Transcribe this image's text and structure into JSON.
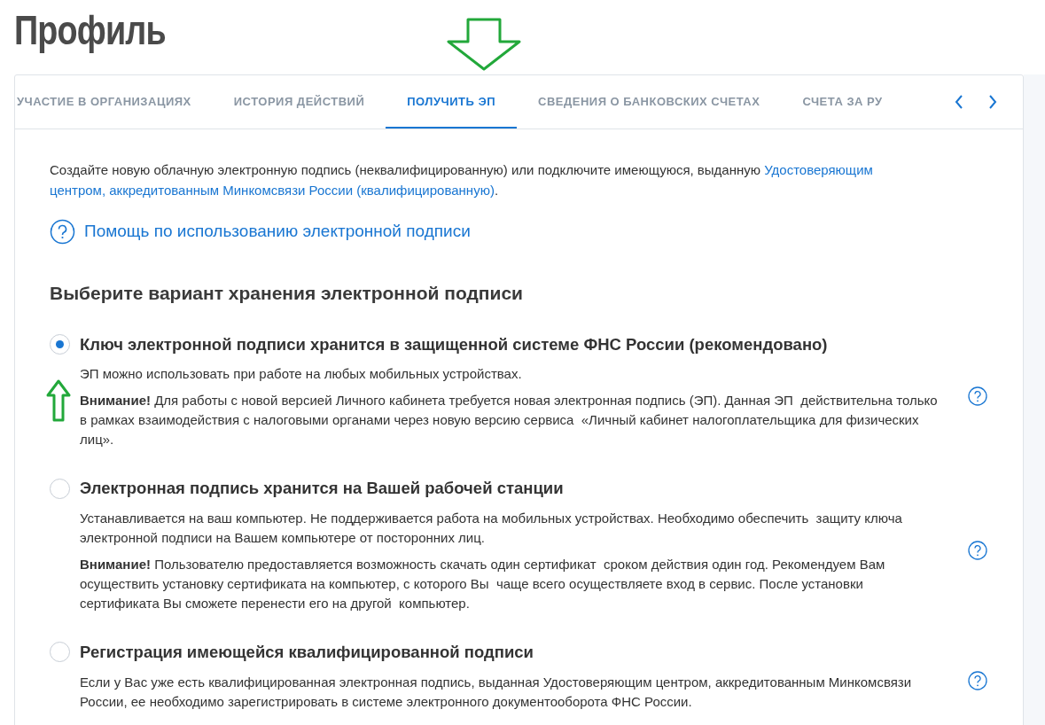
{
  "page_title": "Профиль",
  "tabs": [
    {
      "label": "УЧАСТИЕ В ОРГАНИЗАЦИЯХ",
      "selected": false
    },
    {
      "label": "ИСТОРИЯ ДЕЙСТВИЙ",
      "selected": false
    },
    {
      "label": "ПОЛУЧИТЬ ЭП",
      "selected": true
    },
    {
      "label": "СВЕДЕНИЯ О БАНКОВСКИХ СЧЕТАХ",
      "selected": false
    },
    {
      "label": "СЧЕТА ЗА РУ",
      "selected": false
    }
  ],
  "intro": {
    "text": "Создайте новую облачную электронную подпись (неквалифицированную) или подключите имеющуюся, выданную ",
    "link": "Удостоверяющим центром, аккредитованным Минкомсвязи России (квалифицированную)",
    "after": "."
  },
  "help_link": "Помощь по использованию электронной подписи",
  "section_title": "Выберите вариант хранения электронной подписи",
  "options": [
    {
      "title": "Ключ электронной подписи хранится в защищенной системе ФНС России (рекомендовано)",
      "selected": true,
      "paragraphs": [
        "ЭП можно использовать при работе на любых мобильных устройствах.",
        "**Внимание!** Для работы с новой версией Личного кабинета требуется новая электронная подпись (ЭП). Данная ЭП  действительна только в рамках взаимодействия с налоговыми органами через новую версию сервиса  «Личный кабинет налогоплательщика для физических лиц»."
      ]
    },
    {
      "title": "Электронная подпись хранится на Вашей рабочей станции",
      "selected": false,
      "paragraphs": [
        "Устанавливается на ваш компьютер. Не поддерживается работа на мобильных устройствах. Необходимо обеспечить  защиту ключа электронной подписи на Вашем компьютере от посторонних лиц.",
        "**Внимание!** Пользователю предоставляется возможность скачать один сертификат  сроком действия один год. Рекомендуем Вам осуществить установку сертификата на компьютер, с которого Вы  чаще всего осуществляете вход в сервис. После установки сертификата Вы сможете перенести его на другой  компьютер."
      ]
    },
    {
      "title": "Регистрация имеющейся квалифицированной подписи",
      "selected": false,
      "paragraphs": [
        "Если у Вас уже есть квалифицированная электронная подпись, выданная Удостоверяющим центром, аккредитованным Минкомсвязи России, ее необходимо зарегистрировать в системе электронного документооборота ФНС России."
      ]
    }
  ]
}
